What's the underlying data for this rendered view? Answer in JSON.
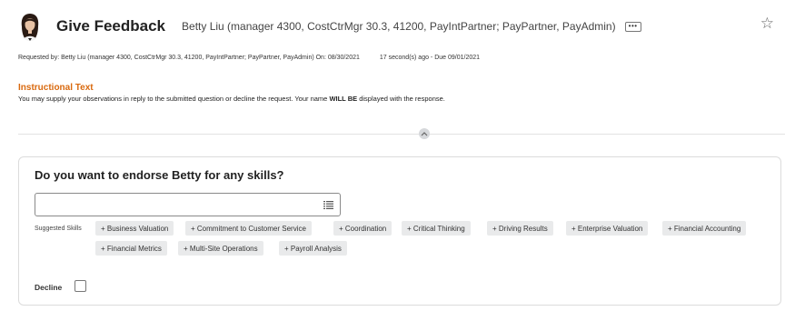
{
  "header": {
    "title": "Give Feedback",
    "context": "Betty Liu (manager 4300, CostCtrMgr 30.3, 41200, PayIntPartner; PayPartner, PayAdmin)",
    "more_glyph": "•••",
    "star_glyph": "☆"
  },
  "request": {
    "requested_by": "Requested by: Betty Liu (manager 4300, CostCtrMgr 30.3, 41200, PayIntPartner; PayPartner, PayAdmin) On: 08/30/2021",
    "timing": "17 second(s) ago - Due 09/01/2021"
  },
  "instructions": {
    "title": "Instructional Text",
    "text_before": "You may supply your observations in reply to the submitted question or decline the request. Your name ",
    "text_bold": "WILL BE",
    "text_after": " displayed with the response."
  },
  "question": {
    "text": "Do you want to endorse Betty for any skills?",
    "input_value": "",
    "suggested_label": "Suggested Skills",
    "skills": [
      "+ Business Valuation",
      "+ Commitment to Customer Service",
      "+ Coordination",
      "+ Critical Thinking",
      "+ Driving Results",
      "+ Enterprise Valuation",
      "+ Financial Accounting",
      "+ Financial Metrics",
      "+ Multi-Site Operations",
      "+ Payroll Analysis"
    ],
    "decline_label": "Decline",
    "decline_checked": false
  },
  "colors": {
    "accent_orange": "#d9690e",
    "chip_bg": "#e9eaeb",
    "border": "#dcdcdc"
  },
  "icons": [
    "avatar",
    "more-icon",
    "star-icon",
    "list-icon",
    "collapse-icon",
    "checkbox"
  ]
}
